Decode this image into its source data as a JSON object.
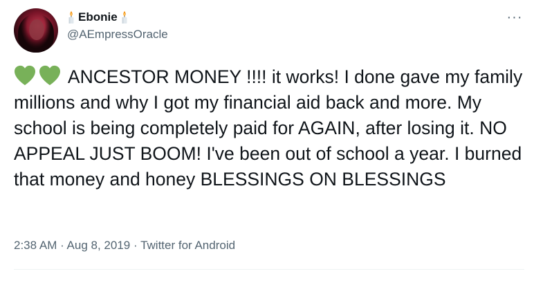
{
  "user": {
    "display_name": "Ebonie",
    "handle": "@AEmpressOracle",
    "name_emoji": "candle-icon"
  },
  "tweet": {
    "emoji": [
      "green-heart-icon",
      "green-heart-icon"
    ],
    "text": "ANCESTOR MONEY !!!! it works! I done gave my family millions and why I got my financial aid back and more. My school is being completely paid for AGAIN, after losing it. NO APPEAL JUST BOOM! I've been out of school a year. I burned that money and honey BLESSINGS ON BLESSINGS"
  },
  "meta": {
    "time": "2:38 AM",
    "separator": " · ",
    "date": "Aug 8, 2019",
    "source": "Twitter for Android"
  },
  "menu": {
    "more_label": "···"
  },
  "colors": {
    "text": "#0f1419",
    "secondary": "#536471",
    "heart": "#78b159",
    "divider": "#eff3f4"
  }
}
